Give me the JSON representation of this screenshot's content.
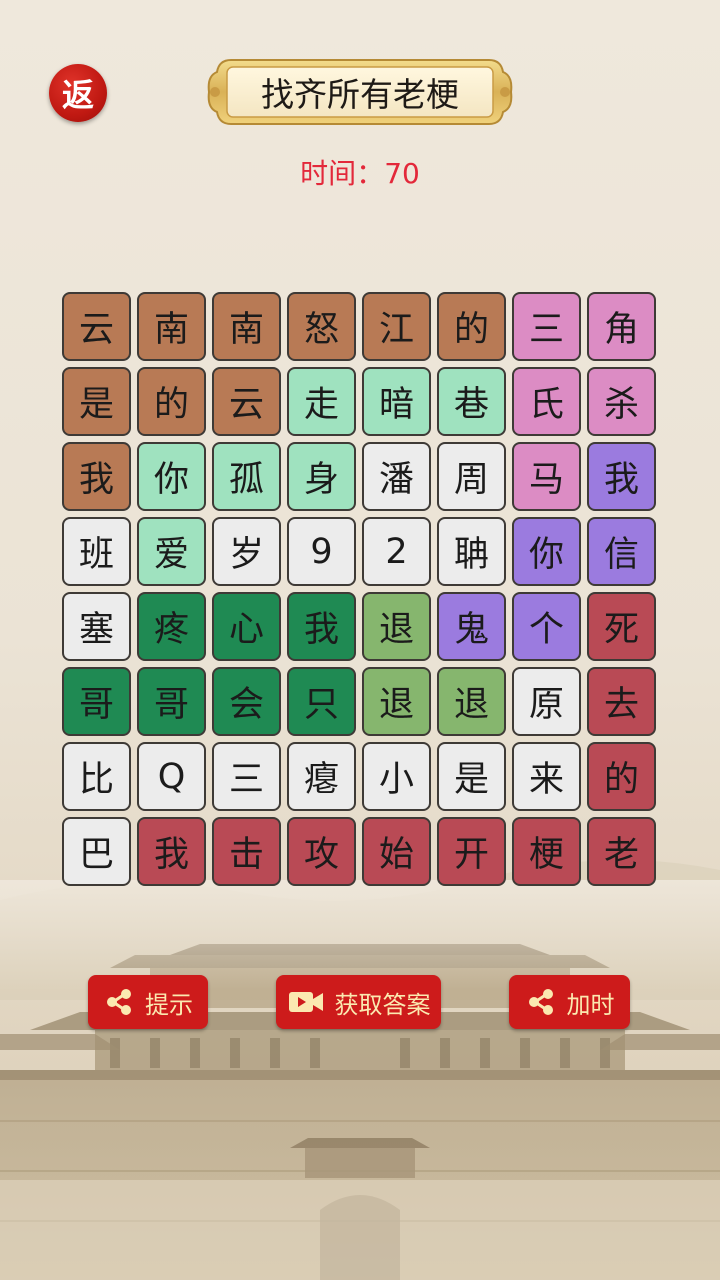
{
  "header": {
    "back_label": "返",
    "title": "找齐所有老梗"
  },
  "timer": {
    "label": "时间：",
    "value": "70"
  },
  "board": {
    "rows": [
      [
        {
          "char": "云",
          "color": "#b87a55"
        },
        {
          "char": "南",
          "color": "#b87a55"
        },
        {
          "char": "南",
          "color": "#b87a55"
        },
        {
          "char": "怒",
          "color": "#b87a55"
        },
        {
          "char": "江",
          "color": "#b87a55"
        },
        {
          "char": "的",
          "color": "#b87a55"
        },
        {
          "char": "三",
          "color": "#dc8cc4"
        },
        {
          "char": "角",
          "color": "#dc8cc4"
        }
      ],
      [
        {
          "char": "是",
          "color": "#b87a55"
        },
        {
          "char": "的",
          "color": "#b87a55"
        },
        {
          "char": "云",
          "color": "#b87a55"
        },
        {
          "char": "走",
          "color": "#9fe2bf"
        },
        {
          "char": "暗",
          "color": "#9fe2bf"
        },
        {
          "char": "巷",
          "color": "#9fe2bf"
        },
        {
          "char": "氏",
          "color": "#dc8cc4"
        },
        {
          "char": "杀",
          "color": "#dc8cc4"
        }
      ],
      [
        {
          "char": "我",
          "color": "#b87a55"
        },
        {
          "char": "你",
          "color": "#9fe2bf"
        },
        {
          "char": "孤",
          "color": "#9fe2bf"
        },
        {
          "char": "身",
          "color": "#9fe2bf"
        },
        {
          "char": "潘",
          "color": "#ececec"
        },
        {
          "char": "周",
          "color": "#ececec"
        },
        {
          "char": "马",
          "color": "#dc8cc4"
        },
        {
          "char": "我",
          "color": "#9b7bdf"
        }
      ],
      [
        {
          "char": "班",
          "color": "#ececec"
        },
        {
          "char": "爱",
          "color": "#9fe2bf"
        },
        {
          "char": "岁",
          "color": "#ececec"
        },
        {
          "char": "9",
          "color": "#ececec"
        },
        {
          "char": "2",
          "color": "#ececec"
        },
        {
          "char": "聃",
          "color": "#ececec"
        },
        {
          "char": "你",
          "color": "#9b7bdf"
        },
        {
          "char": "信",
          "color": "#9b7bdf"
        }
      ],
      [
        {
          "char": "塞",
          "color": "#ececec"
        },
        {
          "char": "疼",
          "color": "#1f8a53"
        },
        {
          "char": "心",
          "color": "#1f8a53"
        },
        {
          "char": "我",
          "color": "#1f8a53"
        },
        {
          "char": "退",
          "color": "#86b66e"
        },
        {
          "char": "鬼",
          "color": "#9b7bdf"
        },
        {
          "char": "个",
          "color": "#9b7bdf"
        },
        {
          "char": "死",
          "color": "#b94a55"
        }
      ],
      [
        {
          "char": "哥",
          "color": "#1f8a53"
        },
        {
          "char": "哥",
          "color": "#1f8a53"
        },
        {
          "char": "会",
          "color": "#1f8a53"
        },
        {
          "char": "只",
          "color": "#1f8a53"
        },
        {
          "char": "退",
          "color": "#86b66e"
        },
        {
          "char": "退",
          "color": "#86b66e"
        },
        {
          "char": "原",
          "color": "#ececec"
        },
        {
          "char": "去",
          "color": "#b94a55"
        }
      ],
      [
        {
          "char": "比",
          "color": "#ececec"
        },
        {
          "char": "Q",
          "color": "#ececec"
        },
        {
          "char": "三",
          "color": "#ececec"
        },
        {
          "char": "瘪",
          "color": "#ececec"
        },
        {
          "char": "小",
          "color": "#ececec"
        },
        {
          "char": "是",
          "color": "#ececec"
        },
        {
          "char": "来",
          "color": "#ececec"
        },
        {
          "char": "的",
          "color": "#b94a55"
        }
      ],
      [
        {
          "char": "巴",
          "color": "#ececec"
        },
        {
          "char": "我",
          "color": "#b94a55"
        },
        {
          "char": "击",
          "color": "#b94a55"
        },
        {
          "char": "攻",
          "color": "#b94a55"
        },
        {
          "char": "始",
          "color": "#b94a55"
        },
        {
          "char": "开",
          "color": "#b94a55"
        },
        {
          "char": "梗",
          "color": "#b94a55"
        },
        {
          "char": "老",
          "color": "#b94a55"
        }
      ]
    ]
  },
  "actions": {
    "hint": {
      "label": "提示",
      "icon": "share-icon"
    },
    "answer": {
      "label": "获取答案",
      "icon": "video-icon"
    },
    "time": {
      "label": "加时",
      "icon": "share-icon"
    }
  },
  "colors": {
    "accent_red": "#cd1b1b",
    "timer_red": "#e3283a",
    "button_text": "#fbe9b0"
  }
}
